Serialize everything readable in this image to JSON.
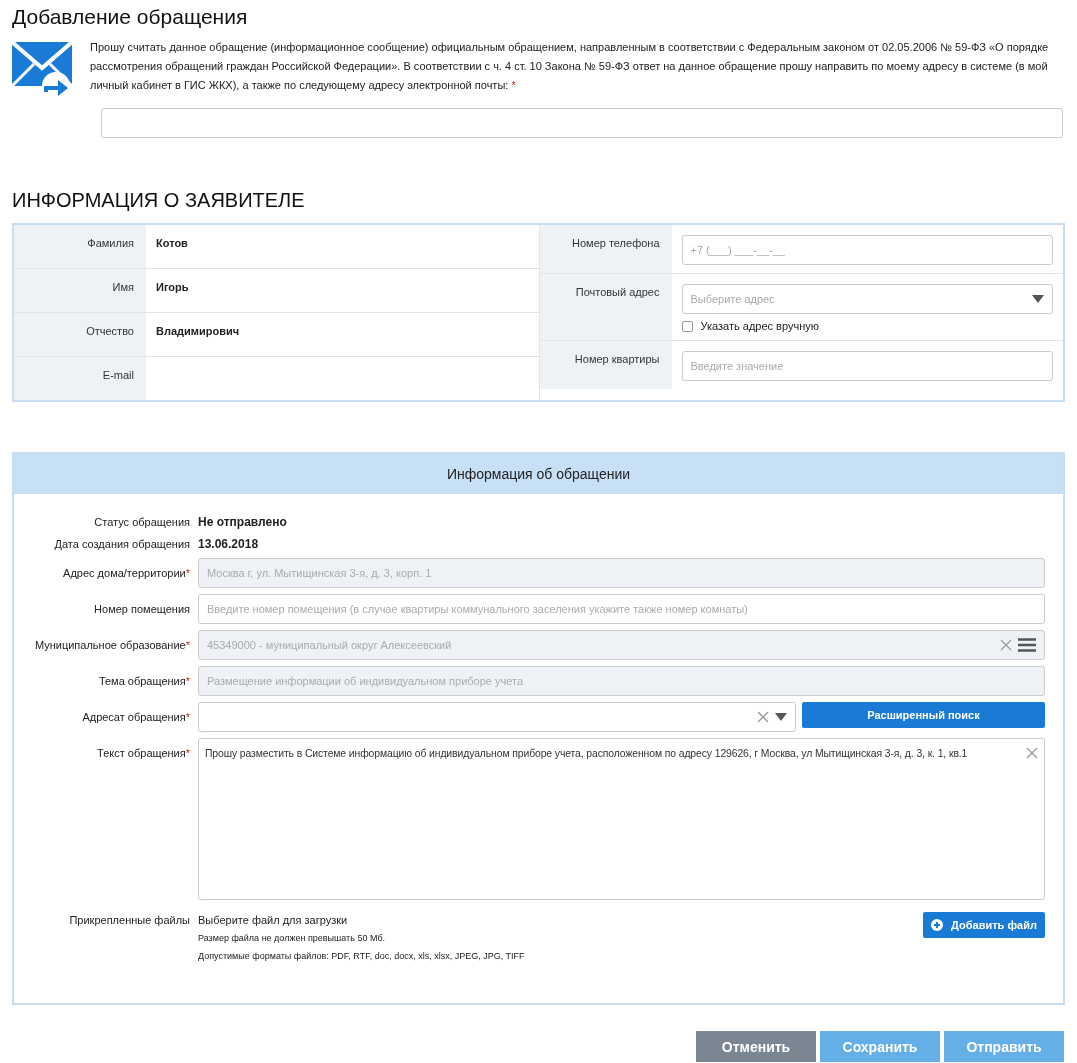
{
  "page_title": "Добавление обращения",
  "consent": {
    "text": "Прошу считать данное обращение (информационное сообщение) официальным обращением, направленным в соответствии с Федеральным законом от 02.05.2006 № 59-ФЗ «О порядке рассмотрения обращений граждан Российской Федерации». В соответствии с ч. 4 ст. 10 Закона № 59-ФЗ ответ на данное обращение прошу направить по моему адресу в системе (в мой личный кабинет в ГИС ЖКХ), а также по следующему адресу электронной почты:",
    "required_mark": "*"
  },
  "applicant": {
    "title": "ИНФОРМАЦИЯ О ЗАЯВИТЕЛЕ",
    "left_rows": [
      {
        "label": "Фамилия",
        "value": "Котов"
      },
      {
        "label": "Имя",
        "value": "Игорь"
      },
      {
        "label": "Отчество",
        "value": "Владимирович"
      },
      {
        "label": "E-mail"
      }
    ],
    "right_rows": [
      {
        "label": "Номер телефона",
        "kind": "input",
        "placeholder": "+7 (___) ___-__-__"
      },
      {
        "label": "Почтовый адрес",
        "kind": "select",
        "placeholder": "Выберите адрес",
        "checkbox": {
          "label": "Указать адрес вручную",
          "checked": false
        }
      },
      {
        "label": "Номер квартиры",
        "kind": "input",
        "placeholder": "Введите значение"
      }
    ]
  },
  "request": {
    "title": "Информация об обращении",
    "fields": [
      {
        "kind": "static",
        "label": "Статус обращения",
        "value": "Не отправлено"
      },
      {
        "kind": "static",
        "label": "Дата создания обращения",
        "value": "13.06.2018"
      },
      {
        "kind": "input",
        "label": "Адрес дома/территории",
        "required": true,
        "disabled": true,
        "value": "Москва г, ул. Мытищинская 3-я, д. 3, корп. 1"
      },
      {
        "kind": "input",
        "label": "Номер помещения",
        "required": false,
        "disabled": false,
        "placeholder": "Введите номер помещения (в случае квартиры коммунального заселения укажите также номер комнаты)"
      },
      {
        "kind": "lookup",
        "label": "Муниципальное образование",
        "required": true,
        "disabled": true,
        "value": "45349000 - муниципальный округ Алексеевский"
      },
      {
        "kind": "input",
        "label": "Тема обращения",
        "required": true,
        "disabled": true,
        "value": "Размещение информации об индивидуальном приборе учета"
      },
      {
        "kind": "combo",
        "label": "Адресат обращения",
        "required": true,
        "disabled": false,
        "button": "Расширенный поиск"
      },
      {
        "kind": "textarea",
        "label": "Текст обращения",
        "required": true,
        "disabled": false,
        "value": "Прошу разместить в Системе информацию об индивидуальном приборе учета, расположенном по адресу 129626, г Москва, ул Мытищинская 3-я, д. 3, к. 1, кв.1"
      },
      {
        "kind": "files",
        "label": "Прикрепленные файлы",
        "prompt": "Выберите файл для загрузки",
        "notes": [
          "Размер файла не должен превышать 50 Мб.",
          "Допустимые форматы файлов: PDF, RTF, doc, docx, xls, xlsx, JPEG, JPG, TIFF"
        ],
        "button": "Добавить файл"
      }
    ]
  },
  "actions": [
    {
      "label": "Отменить",
      "kind": "cancel",
      "disabled": false
    },
    {
      "label": "Сохранить",
      "kind": "primary",
      "disabled": true
    },
    {
      "label": "Отправить",
      "kind": "primary",
      "disabled": true
    }
  ]
}
